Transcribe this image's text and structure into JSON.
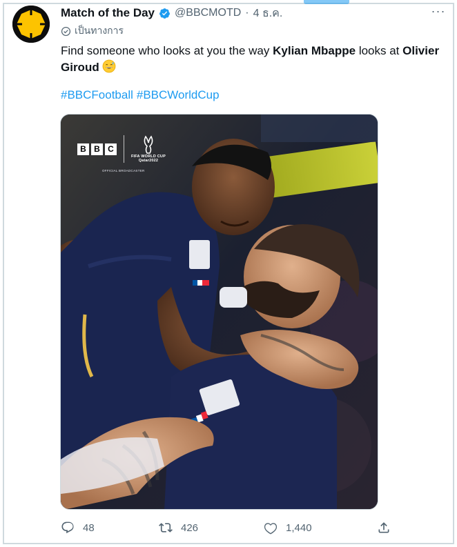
{
  "tweet": {
    "display_name": "Match of the Day",
    "handle": "@BBCMOTD",
    "separator": "·",
    "timestamp": "4 ธ.ค.",
    "official_label": "เป็นทางการ",
    "more_label": "···",
    "text_parts": {
      "p1": "Find someone who looks at you the way ",
      "p2": "Kylian Mbappe",
      "p3": " looks at ",
      "p4": "Olivier Giroud"
    },
    "emoji": "grinning-sweat-emoji",
    "hashtags": [
      "#BBCFootball",
      "#BBCWorldCup"
    ]
  },
  "media": {
    "bbc_letters": [
      "B",
      "B",
      "C"
    ],
    "wc_line1": "FIFA WORLD CUP",
    "wc_line2": "Qatar2022",
    "broadcaster": "OFFICIAL BROADCASTER"
  },
  "actions": {
    "replies": "48",
    "retweets": "426",
    "likes": "1,440"
  },
  "colors": {
    "accent": "#1d9bf0",
    "text": "#0f1419",
    "muted": "#536471",
    "border": "#cfd9de",
    "avatar_yellow": "#fdc300"
  },
  "icons": {
    "verified": "verified-badge-icon",
    "official": "check-circle-icon",
    "reply": "reply-icon",
    "retweet": "retweet-icon",
    "like": "heart-icon",
    "share": "share-icon"
  }
}
